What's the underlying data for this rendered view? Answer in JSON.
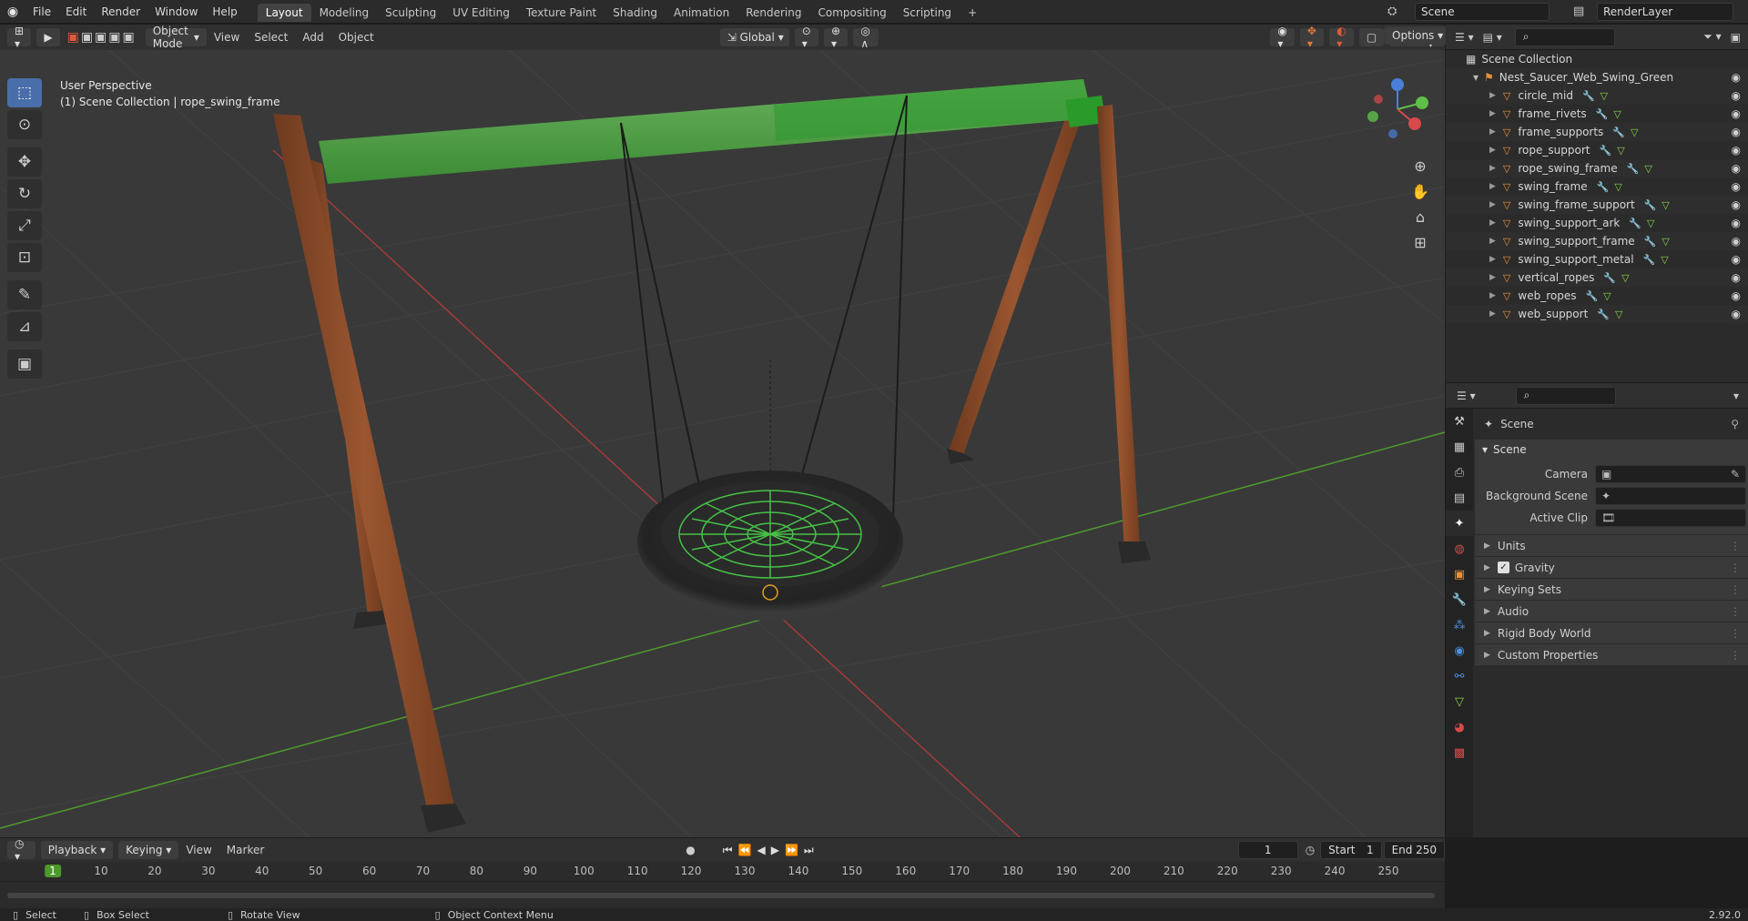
{
  "topbar": {
    "menus": [
      "File",
      "Edit",
      "Render",
      "Window",
      "Help"
    ],
    "workspaces": [
      "Layout",
      "Modeling",
      "Sculpting",
      "UV Editing",
      "Texture Paint",
      "Shading",
      "Animation",
      "Rendering",
      "Compositing",
      "Scripting"
    ],
    "active_workspace": "Layout",
    "add_tab": "+",
    "scene": "Scene",
    "view_layer": "RenderLayer"
  },
  "viewport_header": {
    "mode": "Object Mode",
    "menus": [
      "View",
      "Select",
      "Add",
      "Object"
    ],
    "transform_orientation": "Global",
    "options": "Options"
  },
  "viewport": {
    "perspective": "User Perspective",
    "context": "(1) Scene Collection | rope_swing_frame"
  },
  "outliner": {
    "root": "Scene Collection",
    "collection": "Nest_Saucer_Web_Swing_Green",
    "objects": [
      "circle_mid",
      "frame_rivets",
      "frame_supports",
      "rope_support",
      "rope_swing_frame",
      "swing_frame",
      "swing_frame_support",
      "swing_support_ark",
      "swing_support_frame",
      "swing_support_metal",
      "vertical_ropes",
      "web_ropes",
      "web_support"
    ]
  },
  "properties": {
    "breadcrumb": "Scene",
    "panel": "Scene",
    "camera_label": "Camera",
    "background_label": "Background Scene",
    "clip_label": "Active Clip",
    "subpanels": [
      "Units",
      "Gravity",
      "Keying Sets",
      "Audio",
      "Rigid Body World",
      "Custom Properties"
    ],
    "gravity_checked": true
  },
  "timeline": {
    "menus": [
      "Playback",
      "Keying",
      "View",
      "Marker"
    ],
    "current_frame": "1",
    "start_label": "Start",
    "start": "1",
    "end_label": "End",
    "end": "250",
    "ticks": [
      "1",
      "10",
      "20",
      "30",
      "40",
      "50",
      "60",
      "70",
      "80",
      "90",
      "100",
      "110",
      "120",
      "130",
      "140",
      "150",
      "160",
      "170",
      "180",
      "190",
      "200",
      "210",
      "220",
      "230",
      "240",
      "250"
    ]
  },
  "statusbar": {
    "select": "Select",
    "box_select": "Box Select",
    "rotate": "Rotate View",
    "context_menu": "Object Context Menu",
    "version": "2.92.0"
  },
  "colors": {
    "accent": "#4a6ea9",
    "wood": "#8a4a2a",
    "green": "#3aa43a",
    "grid_green": "#4f9a2e",
    "grid_red": "#a23a3a"
  }
}
